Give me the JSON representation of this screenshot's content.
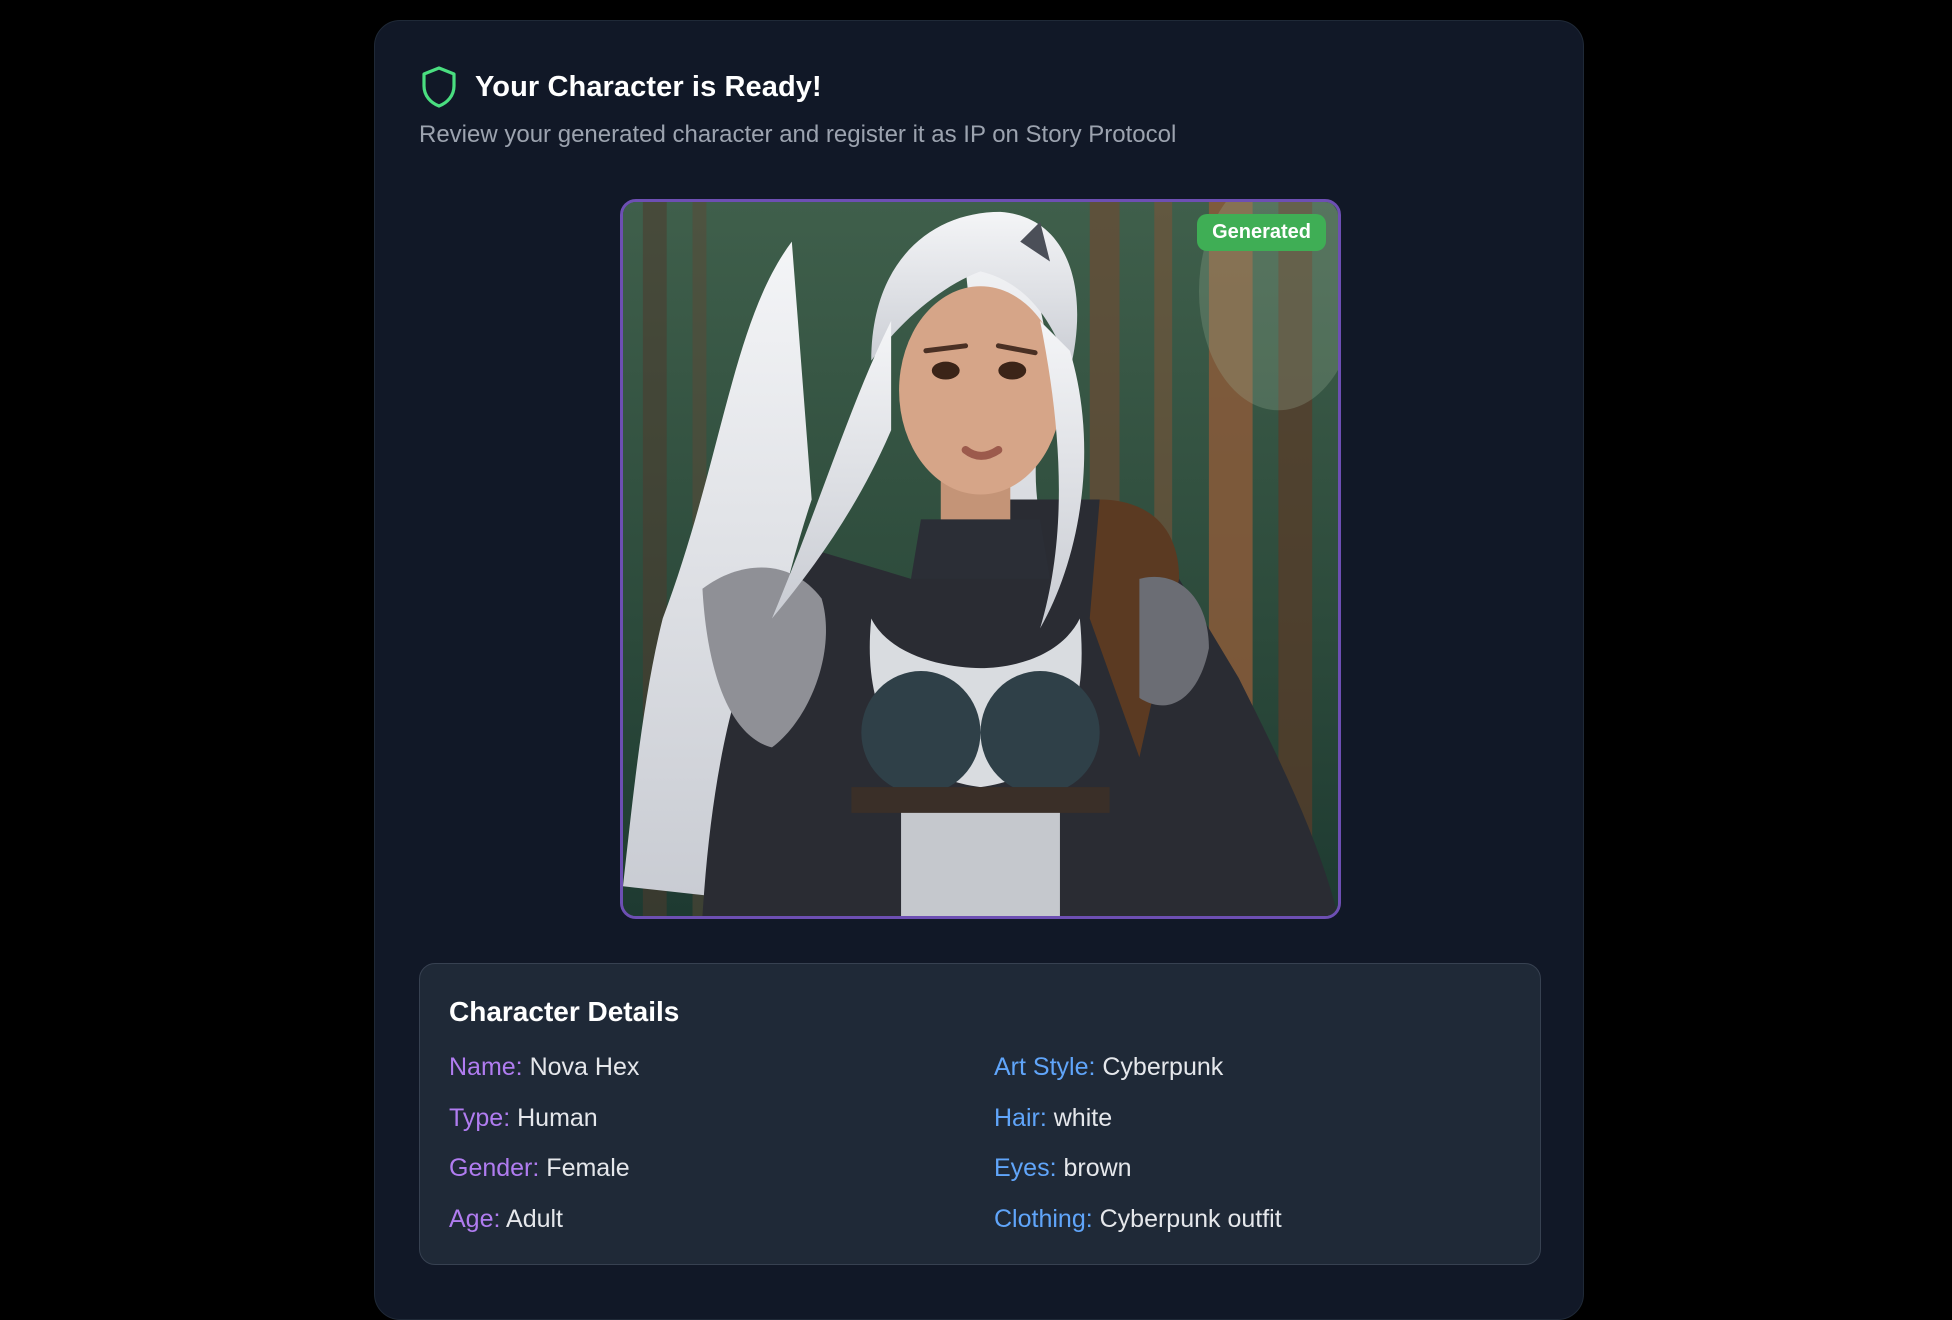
{
  "header": {
    "title": "Your Character is Ready!",
    "subtitle": "Review your generated character and register it as IP on Story Protocol",
    "icon": "shield-icon",
    "icon_color": "#4ade80"
  },
  "preview": {
    "badge": "Generated",
    "badge_color": "#3fae55",
    "frame_color": "#6d4fb3"
  },
  "details": {
    "title": "Character Details",
    "left": [
      {
        "key": "Name:",
        "value": "Nova Hex"
      },
      {
        "key": "Type:",
        "value": "Human"
      },
      {
        "key": "Gender:",
        "value": "Female"
      },
      {
        "key": "Age:",
        "value": "Adult"
      }
    ],
    "right": [
      {
        "key": "Art Style:",
        "value": "Cyberpunk"
      },
      {
        "key": "Hair:",
        "value": "white"
      },
      {
        "key": "Eyes:",
        "value": "brown"
      },
      {
        "key": "Clothing:",
        "value": "Cyberpunk outfit"
      }
    ],
    "left_key_color": "#b07cf0",
    "right_key_color": "#60a5fa"
  }
}
